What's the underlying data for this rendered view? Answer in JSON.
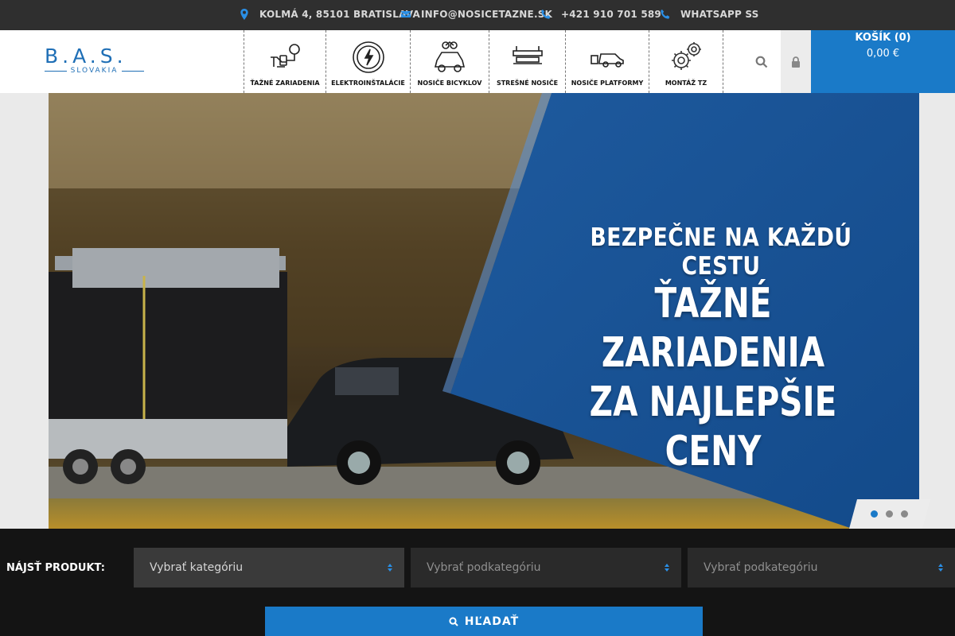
{
  "topbar": {
    "address": "KOLMÁ 4, 85101 BRATISLAVA",
    "email": "INFO@NOSICETAZNE.SK",
    "phone": "+421 910 701 589",
    "whatsapp": "WHATSAPP SS"
  },
  "logo": {
    "main": "B.A.S.",
    "sub": "SLOVAKIA"
  },
  "nav": [
    {
      "label": "ŤAŽNÉ ZARIADENIA",
      "icon": "tow-hitch-icon"
    },
    {
      "label": "ELEKTROINŠTALÁCIE",
      "icon": "electric-plug-icon"
    },
    {
      "label": "NOSIČE BICYKLOV",
      "icon": "bike-carrier-icon"
    },
    {
      "label": "STREŠNÉ NOSIČE",
      "icon": "roof-rack-icon"
    },
    {
      "label": "NOSIČE PLATFORMY",
      "icon": "platform-carrier-icon"
    },
    {
      "label": "MONTÁŽ TZ",
      "icon": "gears-icon"
    }
  ],
  "cart": {
    "label": "KOŠÍK (0)",
    "price": "0,00 €"
  },
  "hero": {
    "line1": "BEZPEČNE NA KAŽDÚ CESTU",
    "line2": "ŤAŽNÉ ZARIADENIA",
    "line3": "ZA NAJLEPŠIE CENY"
  },
  "finder": {
    "label": "NÁJSŤ PRODUKT:",
    "select1": "Vybrať kategóriu",
    "select2": "Vybrať podkategóriu",
    "select3": "Vybrať podkategóriu",
    "button": "HĽADAŤ"
  },
  "colors": {
    "accent": "#1a7ac8",
    "topbar": "#2f2f2f",
    "finder": "#141414"
  }
}
